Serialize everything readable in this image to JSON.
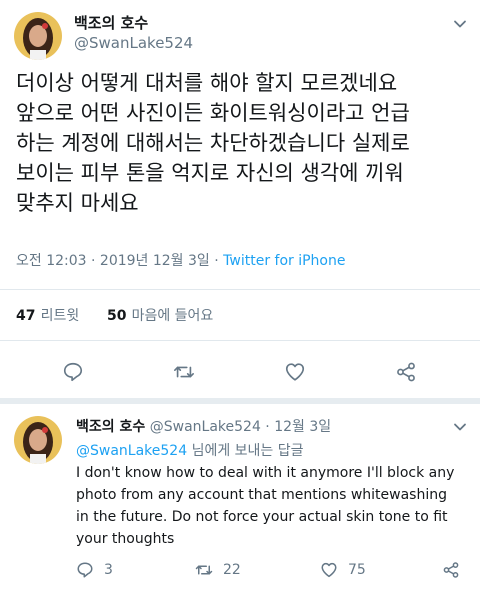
{
  "main_tweet": {
    "display_name": "백조의 호수",
    "handle": "@SwanLake524",
    "text_lines": [
      "더이상 어떻게 대처를 해야 할지 모르겠네요",
      "앞으로 어떤 사진이든 화이트워싱이라고 언급",
      "하는 계정에 대해서는 차단하겠습니다 실제로",
      "보이는 피부 톤을 억지로 자신의 생각에 끼워",
      "맞추지 마세요"
    ],
    "timestamp": "오전 12:03 · 2019년 12월 3일 ·",
    "source": "Twitter for iPhone",
    "retweets_count": "47",
    "retweets_label": "리트윗",
    "likes_count": "50",
    "likes_label": "마음에 들어요"
  },
  "reply_tweet": {
    "display_name": "백조의 호수",
    "handle_date": "@SwanLake524 · 12월 3일",
    "reply_to_handle": "@SwanLake524",
    "reply_to_suffix": "님에게 보내는 답글",
    "text_lines": [
      "I don't know how to deal with it anymore I'll block any",
      "photo from any account that mentions whitewashing",
      "in the future. Do not force your actual skin tone to fit",
      "your thoughts"
    ],
    "reply_count": "3",
    "retweet_count": "22",
    "like_count": "75"
  },
  "colors": {
    "accent": "#1da1f2",
    "secondary_text": "#657786",
    "divider": "#e1e8ed"
  }
}
